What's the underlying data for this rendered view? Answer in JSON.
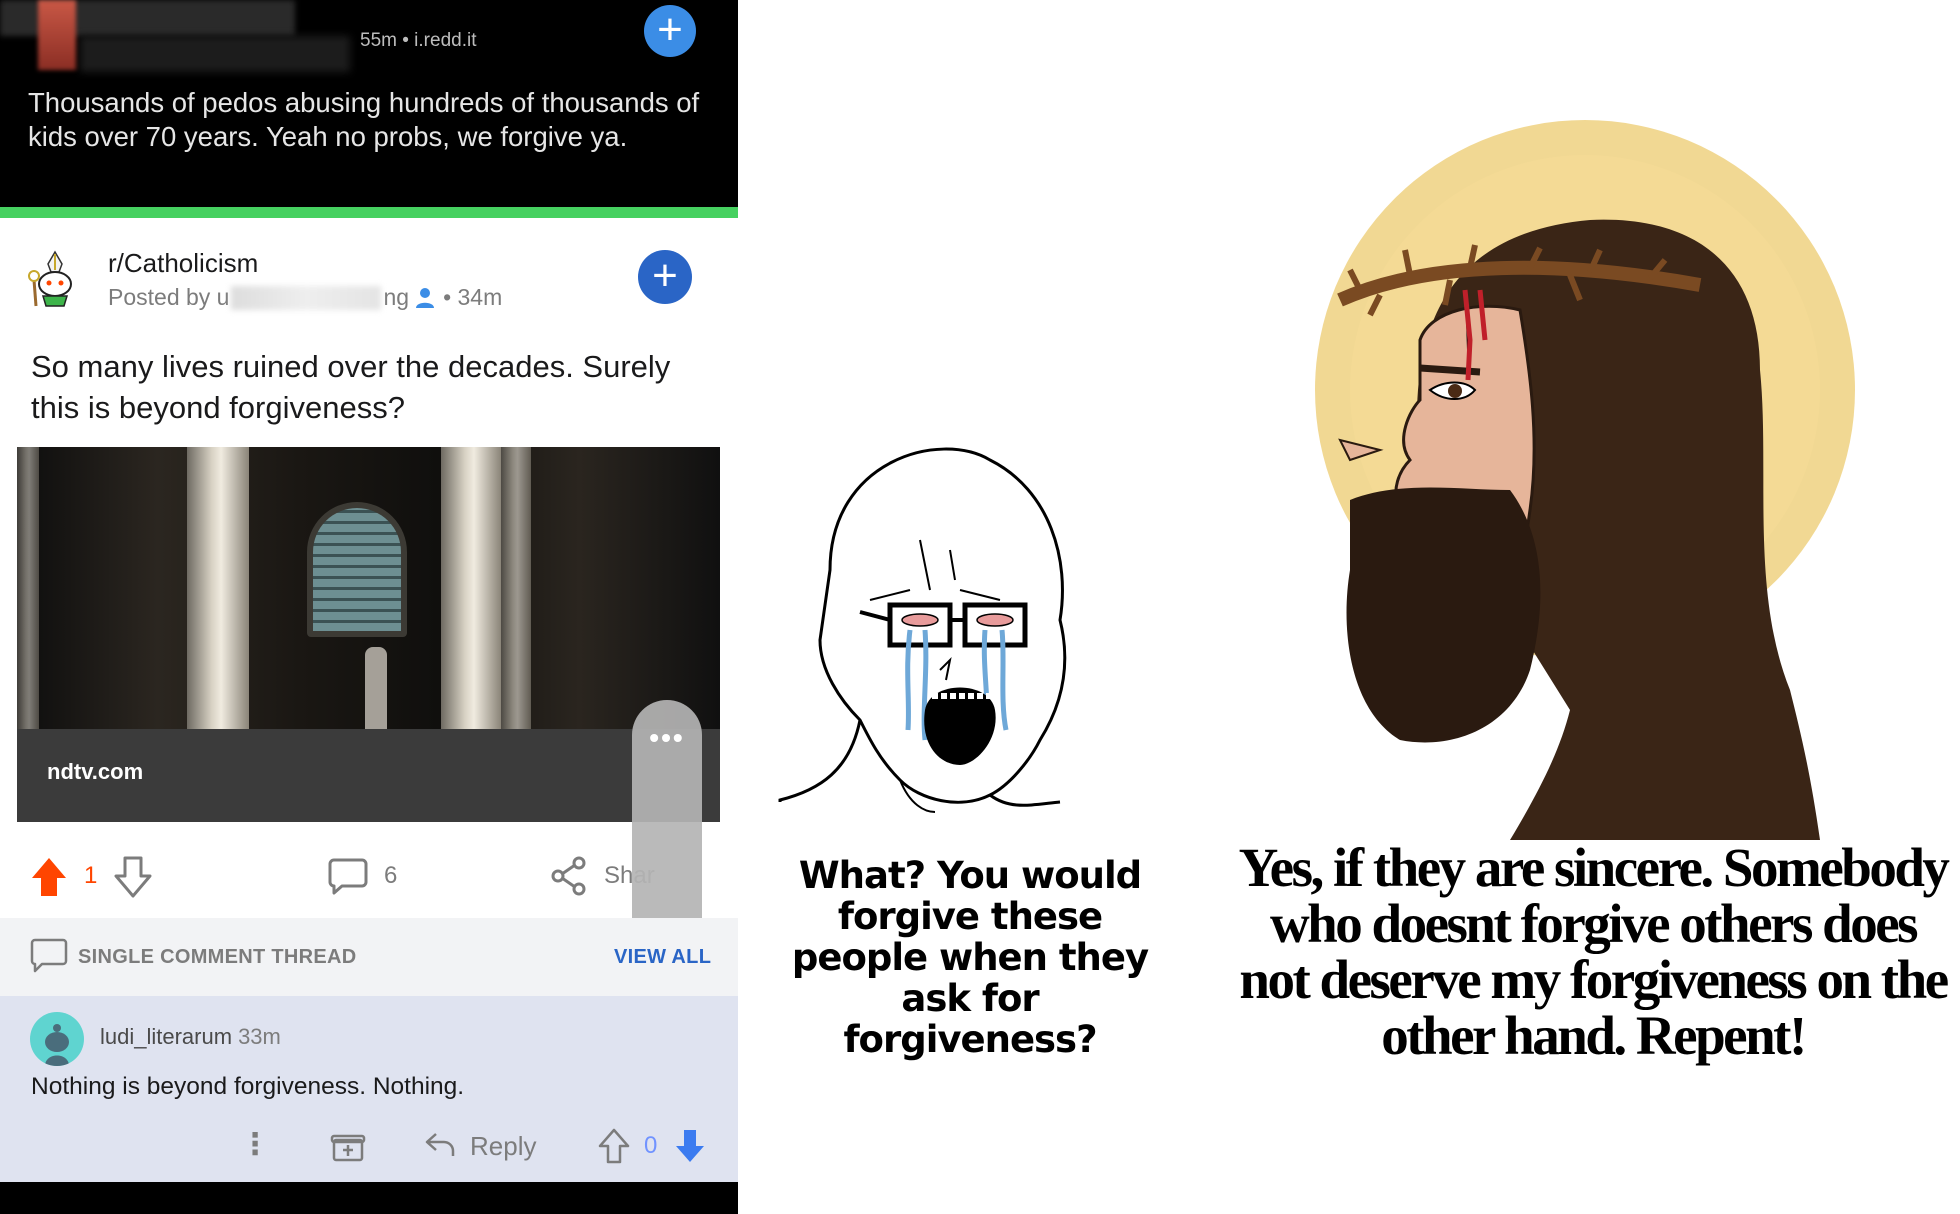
{
  "top_post": {
    "meta": "55m • i.redd.it",
    "text": "Thousands of pedos abusing hundreds of thousands of kids over 70 years. Yeah no probs, we forgive ya.",
    "join_glyph": "+"
  },
  "post": {
    "subreddit": "r/Catholicism",
    "posted_by_prefix": "Posted by u",
    "posted_by_suffix": "ng",
    "age": "• 34m",
    "join_glyph": "+",
    "title": "So many lives ruined over the decades. Surely this is beyond forgiveness?",
    "link_source": "ndtv.com",
    "more_glyph": "•••",
    "vote_count": "1",
    "comment_count": "6",
    "share_label": "Shar"
  },
  "thread": {
    "label": "SINGLE COMMENT THREAD",
    "view_all": "VIEW ALL"
  },
  "comment": {
    "author": "ludi_literarum",
    "age": "33m",
    "text": "Nothing is beyond forgiveness. Nothing.",
    "more_glyph": "⋮",
    "reply_label": "Reply",
    "vote_count": "0"
  },
  "meme": {
    "wojak_caption": "What? You would forgive these people when they ask for forgiveness?",
    "jesus_caption": "Yes, if they are sincere. Somebody who doesnt forgive others does not deserve my forgiveness on the other hand. Repent!"
  },
  "colors": {
    "upvote_active": "#ff4500",
    "join_blue": "#2a65c6",
    "downvote_blue": "#3b7bf0",
    "green_bar": "#46d160"
  },
  "icons": [
    "plus-icon",
    "user-icon",
    "upvote-icon",
    "downvote-icon",
    "comment-icon",
    "share-icon",
    "mute-icon",
    "more-icon",
    "award-icon",
    "reply-icon"
  ]
}
